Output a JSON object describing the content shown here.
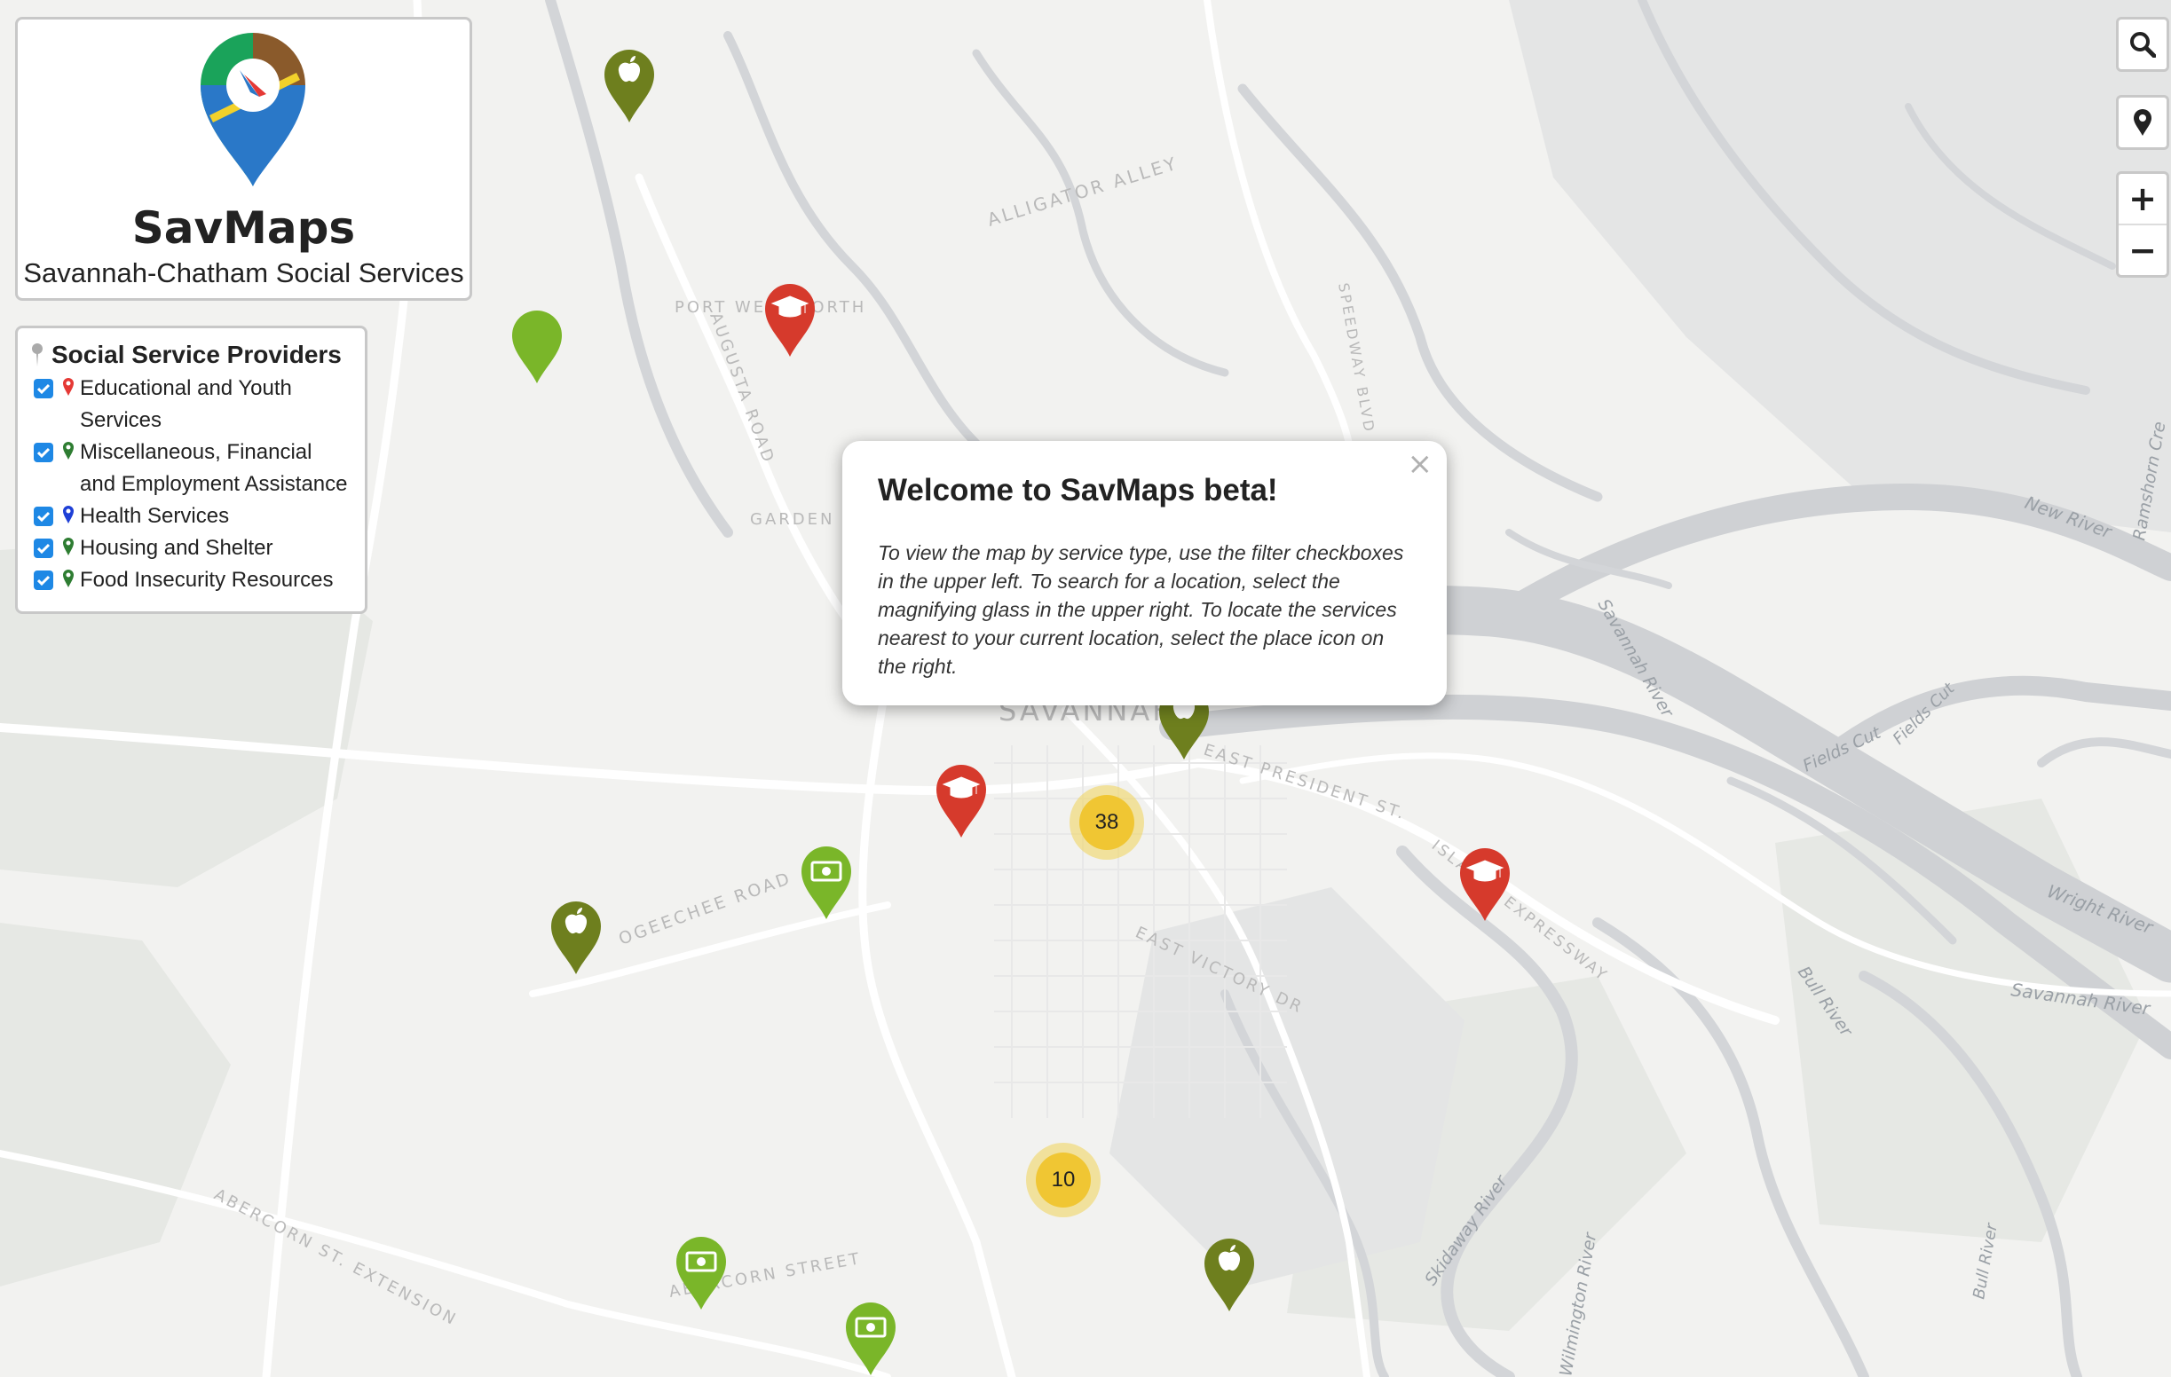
{
  "app": {
    "title": "SavMaps",
    "subtitle": "Savannah-Chatham Social Services"
  },
  "filter_panel": {
    "title": "Social Service Providers",
    "items": [
      {
        "label": "Educational and Youth Services",
        "checked": true,
        "pin_color": "#e53935"
      },
      {
        "label": "Miscellaneous, Financial and Employment Assistance",
        "checked": true,
        "pin_color": "#2e7d32"
      },
      {
        "label": "Health Services",
        "checked": true,
        "pin_color": "#1e3fd6"
      },
      {
        "label": "Housing and Shelter",
        "checked": true,
        "pin_color": "#2e7d32"
      },
      {
        "label": "Food Insecurity Resources",
        "checked": true,
        "pin_color": "#2e7d32"
      }
    ]
  },
  "popup": {
    "title": "Welcome to SavMaps beta!",
    "body": "To view the map by service type, use the filter checkboxes in the upper left. To search for a location, select the magnifying glass in the upper right. To locate the services nearest to your current location, select the place icon on the right.",
    "close": "×"
  },
  "controls": {
    "search_icon": "search-icon",
    "locate_icon": "map-marker-icon",
    "zoom_in": "+",
    "zoom_out": "−"
  },
  "clusters": [
    {
      "count": "38"
    },
    {
      "count": "10"
    }
  ],
  "map_labels": {
    "streets": [
      "ALLIGATOR ALLEY",
      "PORT WENTWORTH",
      "AUGUSTA ROAD",
      "SPEEDWAY BLVD",
      "GARDEN C",
      "SAVANNAH",
      "EAST PRESIDENT ST.",
      "OGEECHEE ROAD",
      "EAST VICTORY DR",
      "ISLANDS EXPRESSWAY",
      "ABERCORN ST. EXTENSION",
      "ABERCORN STREET"
    ],
    "water": [
      "New River",
      "Savannah River",
      "Fields Cut",
      "Fields Cut",
      "Ramshorn Cre",
      "Wright River",
      "Savannah River",
      "Bull River",
      "Skidaway River",
      "Wilmington River",
      "Bull River"
    ]
  },
  "colors": {
    "education": "#d63a2c",
    "food": "#6e7f1e",
    "financial": "#7ab629",
    "cluster": "#f0c633"
  }
}
